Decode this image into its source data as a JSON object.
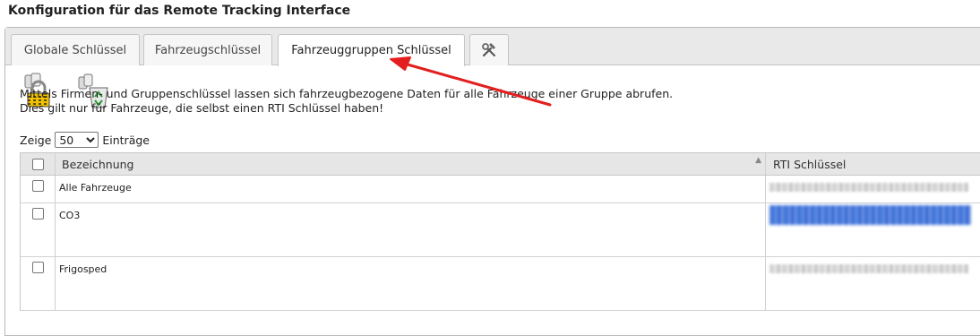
{
  "page": {
    "title": "Konfiguration für das Remote Tracking Interface"
  },
  "tabs": [
    {
      "label": "Globale Schlüssel"
    },
    {
      "label": "Fahrzeugschlüssel"
    },
    {
      "label": "Fahrzeuggruppen Schlüssel",
      "active": true
    },
    {
      "icon": "tools-icon"
    }
  ],
  "toolbar": {
    "icons": [
      "lock-keys-icon",
      "recycle-keys-icon"
    ]
  },
  "description": {
    "line1": "Mittels Firmen- und Gruppenschlüssel lassen sich fahrzeugbezogene Daten für alle Fahrzeuge einer Gruppe abrufen.",
    "line2": "Dies gilt nur für Fahrzeuge, die selbst einen RTI Schlüssel haben!"
  },
  "length_menu": {
    "prefix": "Zeige",
    "value": "50",
    "suffix": "Einträge"
  },
  "table": {
    "columns": [
      "Bezeichnung",
      "RTI Schlüssel"
    ],
    "rows": [
      {
        "name": "Alle Fahrzeuge",
        "key_state": "blurred"
      },
      {
        "name": "CO3",
        "key_state": "selected-blurred"
      },
      {
        "name": "Frigosped",
        "key_state": "blurred"
      }
    ]
  },
  "annotation": {
    "color": "#e41e1e",
    "points_to": "tab-fahrzeuggruppen-schluessel"
  }
}
